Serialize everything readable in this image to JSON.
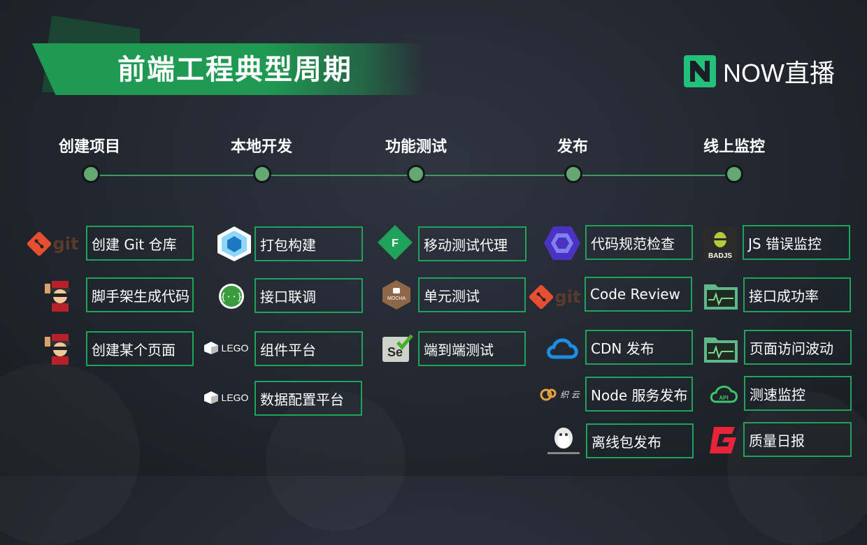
{
  "title": "前端工程典型周期",
  "logo": {
    "text": "NOW直播",
    "color": "#22c07a"
  },
  "accent": "#1fa25a",
  "stages": [
    "创建项目",
    "本地开发",
    "功能测试",
    "发布",
    "线上监控"
  ],
  "columns": [
    {
      "items": [
        {
          "label": "创建 Git 仓库",
          "icon": "git-icon",
          "icon_text": "git"
        },
        {
          "label": "脚手架生成代码",
          "icon": "yeoman-icon"
        },
        {
          "label": "创建某个页面",
          "icon": "yeoman-icon"
        }
      ]
    },
    {
      "items": [
        {
          "label": "打包构建",
          "icon": "webpack-icon"
        },
        {
          "label": "接口联调",
          "icon": "api-braces-icon"
        },
        {
          "label": "组件平台",
          "icon": "lego-icon",
          "icon_text": "LEGO"
        },
        {
          "label": "数据配置平台",
          "icon": "lego-icon",
          "icon_text": "LEGO"
        }
      ]
    },
    {
      "items": [
        {
          "label": "移动测试代理",
          "icon": "proxy-f-icon",
          "icon_text": "F"
        },
        {
          "label": "单元测试",
          "icon": "mocha-icon",
          "icon_text": "MOCHA"
        },
        {
          "label": "端到端测试",
          "icon": "selenium-icon",
          "icon_text": "Se"
        }
      ]
    },
    {
      "items": [
        {
          "label": "代码规范检查",
          "icon": "eslint-icon"
        },
        {
          "label": "Code Review",
          "icon": "git-icon",
          "icon_text": "git"
        },
        {
          "label": "CDN 发布",
          "icon": "cloud-icon"
        },
        {
          "label": "Node 服务发布",
          "icon": "zhiyun-icon",
          "icon_text": "织 云"
        },
        {
          "label": "离线包发布",
          "icon": "penguin-icon"
        }
      ]
    },
    {
      "items": [
        {
          "label": "JS 错误监控",
          "icon": "badjs-icon",
          "icon_text": "BADJS"
        },
        {
          "label": "接口成功率",
          "icon": "folder-chart-icon"
        },
        {
          "label": "页面访问波动",
          "icon": "folder-chart-icon"
        },
        {
          "label": "测速监控",
          "icon": "api-cloud-icon",
          "icon_text": "API"
        },
        {
          "label": "质量日报",
          "icon": "report-g-icon"
        }
      ]
    }
  ]
}
